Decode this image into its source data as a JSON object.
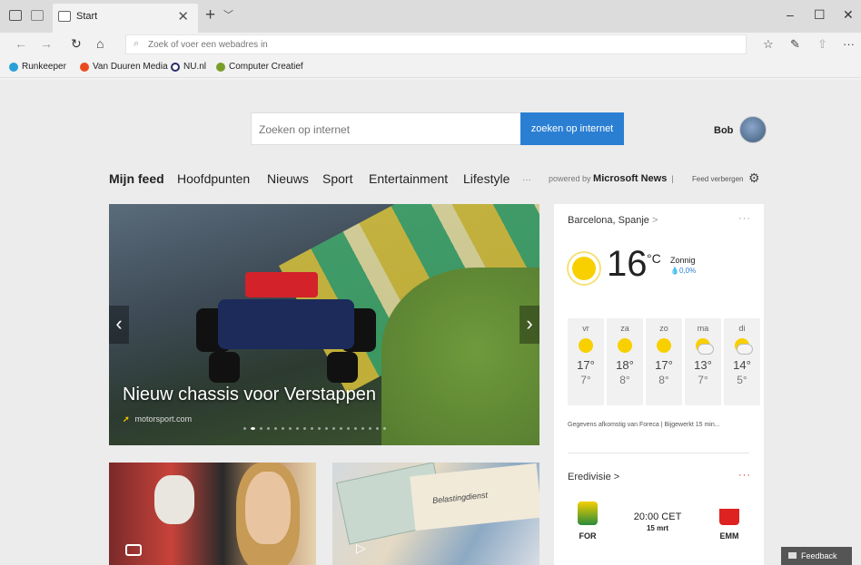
{
  "browser": {
    "tab_title": "Start",
    "tab_close": "✕",
    "new_tab": "+",
    "tab_menu": "﹀",
    "address_placeholder": "Zoek of voer een webadres in",
    "window_controls": {
      "minimize": "–",
      "maximize": "☐",
      "close": "✕"
    }
  },
  "favorites": [
    "Runkeeper",
    "Van Duuren Media",
    "NU.nl",
    "Computer Creatief"
  ],
  "header": {
    "search_placeholder": "Zoeken op internet",
    "search_button": "zoeken op internet",
    "user_name": "Bob"
  },
  "feednav": {
    "items": [
      "Mijn feed",
      "Hoofdpunten",
      "Nieuws",
      "Sport",
      "Entertainment",
      "Lifestyle"
    ],
    "more": "···",
    "powered_by_prefix": "powered by",
    "powered_by_brand": "Microsoft News",
    "separator": "|",
    "hide_feed": "Feed verbergen"
  },
  "hero": {
    "headline": "Nieuw chassis voor Verstappen",
    "source": "motorsport.com",
    "slide_count": 20,
    "active_slide": 1
  },
  "weather": {
    "location": "Barcelona, Spanje",
    "location_arrow": ">",
    "menu": "···",
    "temperature": "16",
    "unit": "°C",
    "condition": "Zonnig",
    "precipitation": "0,0%",
    "forecast": [
      {
        "day": "vr",
        "high": "17°",
        "low": "7°",
        "icon": "sun"
      },
      {
        "day": "za",
        "high": "18°",
        "low": "8°",
        "icon": "sun"
      },
      {
        "day": "zo",
        "high": "17°",
        "low": "8°",
        "icon": "sun"
      },
      {
        "day": "ma",
        "high": "13°",
        "low": "7°",
        "icon": "partly-cloudy"
      },
      {
        "day": "di",
        "high": "14°",
        "low": "5°",
        "icon": "partly-cloudy"
      }
    ],
    "credit": "Gegevens afkomstig van Foreca | Bijgewerkt 15 min..."
  },
  "sports": {
    "league": "Eredivisie",
    "league_arrow": ">",
    "menu": "···",
    "home": "FOR",
    "away": "EMM",
    "time": "20:00 CET",
    "date": "15 mrt"
  },
  "feedback_label": "Feedback",
  "tile2_caption": "Belastingdienst",
  "colors": {
    "accent": "#2b7fd3",
    "tab_bar": "#dcdcdc",
    "page": "#ececec"
  }
}
